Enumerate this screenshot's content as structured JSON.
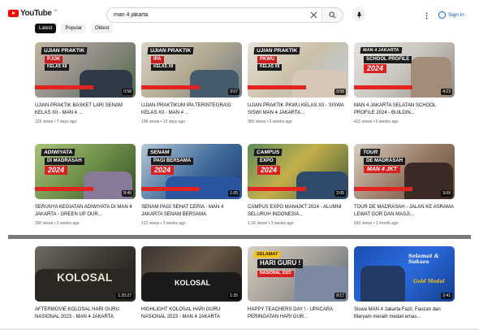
{
  "header": {
    "logo_text": "YouTube",
    "logo_region": "ID",
    "search_value": "man 4 jakarta",
    "signin_label": "Sign in"
  },
  "chips": [
    "Latest",
    "Popular",
    "Oldest"
  ],
  "colors": {
    "brand": "#ff0000",
    "link": "#065fd4"
  },
  "videos": [
    {
      "thumb_label": "UJIAN PRAKTIK",
      "thumb_sub": "PJOK",
      "thumb_tag": "KELAS XII",
      "duration": "0:58",
      "title": "UJIAN PRAKTIK BASKET LARI SENAM KELAS XII - MAN 4 ...",
      "meta": "125 views • 7 days ago"
    },
    {
      "thumb_label": "UJIAN PRAKTIK",
      "thumb_sub": "IPA",
      "thumb_tag": "KELAS XII",
      "duration": "3:07",
      "title": "UJIAN PRAKTIKUM IPA TERINTEGRASI KELAS XII - MAN 4 ...",
      "meta": "198 views • 13 days ago"
    },
    {
      "thumb_label": "UJIAN PRAKTIK",
      "thumb_sub": "PKWU",
      "thumb_tag": "KELAS XII",
      "duration": "0:59",
      "title": "UJIAN PRAKTIK PKWU KELAS XII - SISWA SISWI MAN 4 JAKARTA...",
      "meta": "365 views • 2 weeks ago"
    },
    {
      "thumb_label": "MAN 4 JAKARTA",
      "thumb_sub": "SCHOOL PROFILE",
      "thumb_tag": "2024",
      "duration": "4:23",
      "title": "MAN 4 JAKARTA SELATAN SCHOOL PROFILE 2024 - BUILDIN...",
      "meta": "421 views • 2 weeks ago"
    },
    {
      "thumb_label": "ADIWIYATA",
      "thumb_sub": "DI MADRASAH",
      "thumb_tag": "2024",
      "duration": "8:45",
      "title": "SERUNYA KEGIATAN ADIWIYATA DI MAN 4 JAKARTA - GREEN UP OUR...",
      "meta": "300 views • 2 weeks ago"
    },
    {
      "thumb_label": "SENAM",
      "thumb_sub": "PAGI BERSAMA",
      "thumb_tag": "2024",
      "duration": "1:05",
      "title": "SENAM PAGI SEHAT CERIA - MAN 4 JAKARTA SENAM BERSAMA",
      "meta": "122 views • 3 weeks ago"
    },
    {
      "thumb_label": "CAMPUS",
      "thumb_sub": "EXPO",
      "thumb_tag": "2024",
      "duration": "2:05",
      "title": "CAMPUS EXPO MAN4JKT 2024 - ALUMNI SELURUH INDONESIA...",
      "meta": "1.1K views • 3 weeks ago"
    },
    {
      "thumb_label": "TOUR",
      "thumb_sub": "DE MADRASAH",
      "thumb_tag": "MAN 4 JKT",
      "duration": "3:09",
      "title": "TOUR DE MADRASAH - JALAN KE ASRAMA LEWAT GOR DAN MASJI...",
      "meta": "643 views • 1 month ago"
    },
    {
      "thumb_label": "KOLOSAL",
      "thumb_sub": "",
      "thumb_tag": "",
      "duration": "1:20:27",
      "title": "AFTERMOVIE KOLOSAL HARI GURU NASIONAL 2023 - MAN 4 JAKARTA",
      "meta": ""
    },
    {
      "thumb_label": "KOLOSAL",
      "thumb_sub": "",
      "thumb_tag": "",
      "duration": "1:35",
      "title": "HIGHLIGHT KOLOSAL HARI GURU NASIONAL 2023 - MAN 4 JAKARTA",
      "meta": ""
    },
    {
      "thumb_label": "SELAMAT",
      "thumb_sub": "HARI GURU !",
      "thumb_tag": "NASIONAL 2023",
      "duration": "8:17",
      "title": "HAPPY TEACHERS DAY ! - UPACARA PERINGATAN HARI GUR...",
      "meta": ""
    },
    {
      "thumb_label": "Selamat & Sukses",
      "thumb_sub": "",
      "thumb_tag": "Gold Medal",
      "duration": "2:41",
      "title": "Siswa MAN 4 Jakarta Fazil, Fauzan dan Maryam meraih medali emas...",
      "meta": ""
    }
  ]
}
